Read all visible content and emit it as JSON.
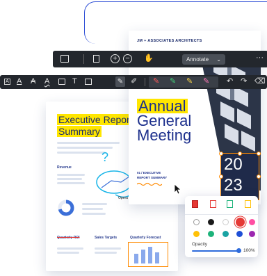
{
  "left_doc": {
    "title_line1": "Executive Report",
    "title_line2": "Summary",
    "revenue_label": "Revenue",
    "opera_label": "Opera",
    "quarterly_roi": "Quarterly ROI",
    "sales_targets": "Sales Targets",
    "quarterly_forecast": "Quarterly Forecast",
    "question_mark": "?"
  },
  "right_doc": {
    "firm": "JM + ASSOCIATES ARCHITECTS",
    "annual": "Annual",
    "general": "General",
    "meeting": "Meeting",
    "sub_line1": "01 / EXECUTIVE",
    "sub_line2": "REPORT SUMMARY",
    "year_top": "20",
    "year_bottom": "23"
  },
  "toolbar_top": {
    "mode_select": "Annotate",
    "more": "···"
  },
  "annotation_toolbar": {
    "text_tool": "T"
  },
  "palette": {
    "opacity_label": "Opacity",
    "opacity_value": "100%",
    "colors": [
      "#1a1a1a",
      "#ffffff",
      "#e53935",
      "#ff4fa3",
      "#ffc107",
      "#1db37a",
      "#1aa3a3",
      "#1f4fd6",
      "#9c27b0"
    ]
  }
}
